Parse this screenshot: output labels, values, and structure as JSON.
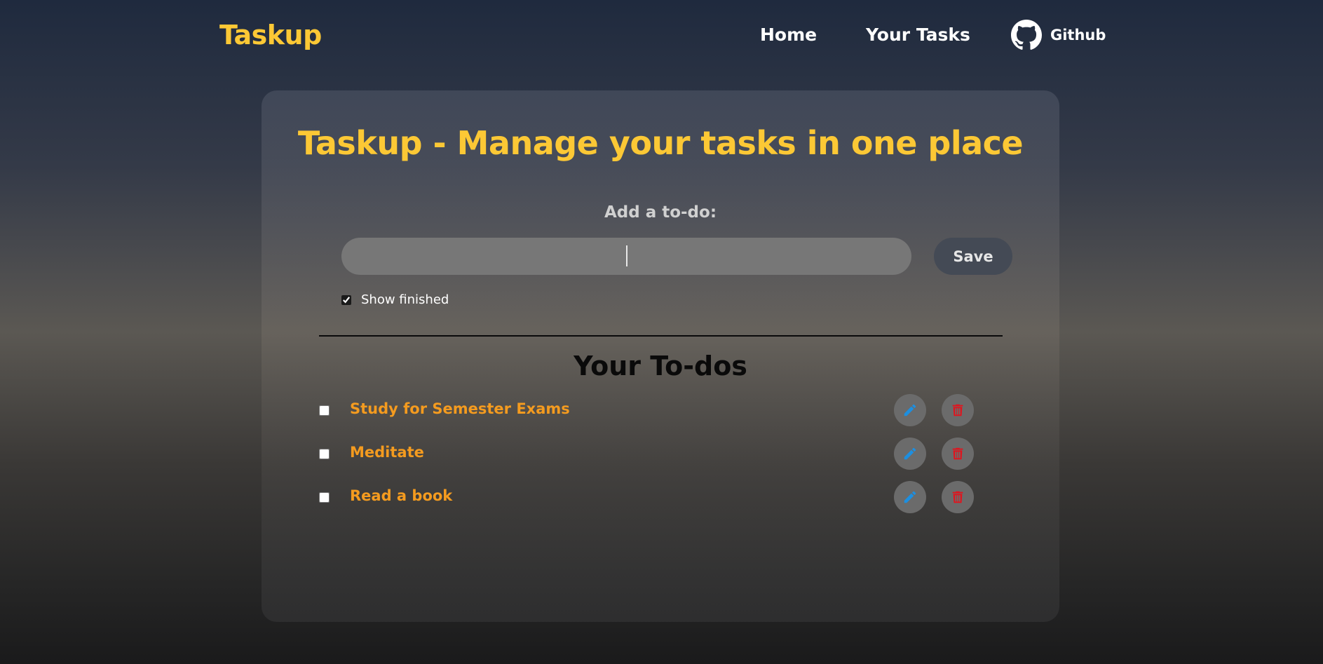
{
  "nav": {
    "logo": "Taskup",
    "home": "Home",
    "your_tasks": "Your Tasks",
    "github": "Github"
  },
  "main": {
    "title": "Taskup - Manage your tasks in one place",
    "add_label": "Add a to-do:",
    "input": {
      "value": "",
      "placeholder": ""
    },
    "save_label": "Save",
    "show_finished_label": "Show finished",
    "show_finished_checked": true,
    "todos_title": "Your To-dos",
    "todos": [
      {
        "text": "Study for Semester Exams",
        "done": false
      },
      {
        "text": "Meditate",
        "done": false
      },
      {
        "text": "Read a book",
        "done": false
      }
    ]
  },
  "colors": {
    "brand": "#fcc835",
    "todo_text": "#f49b1f",
    "edit_icon": "#1d8fe0",
    "delete_icon": "#e0141e"
  },
  "icons": {
    "github": "github-icon",
    "edit": "pencil-icon",
    "delete": "trash-icon"
  }
}
